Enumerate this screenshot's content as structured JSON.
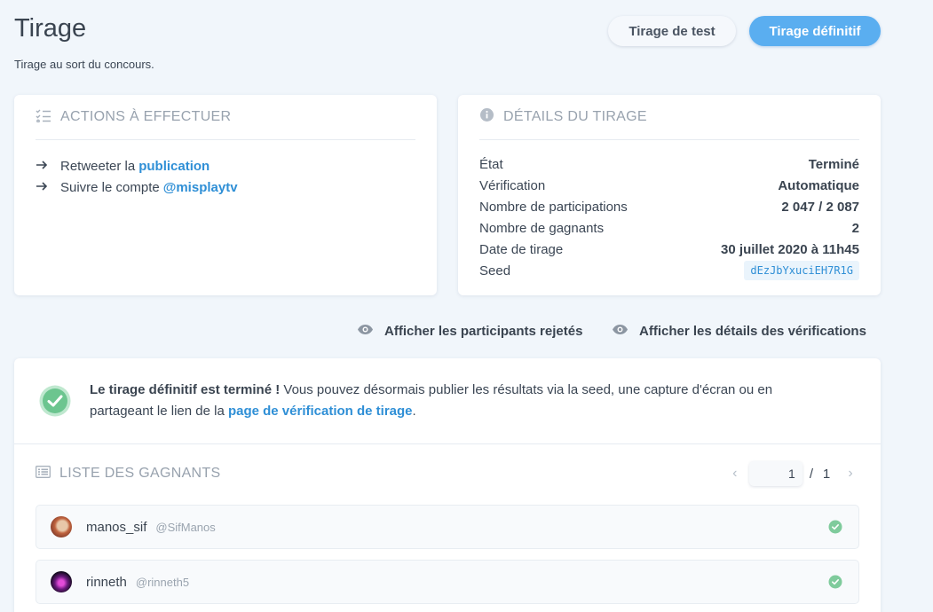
{
  "header": {
    "title": "Tirage",
    "subtitle": "Tirage au sort du concours.",
    "test_button": "Tirage de test",
    "final_button": "Tirage définitif"
  },
  "actions": {
    "title": "ACTIONS À EFFECTUER",
    "items": [
      {
        "text": "Retweeter la",
        "link": "publication"
      },
      {
        "text": "Suivre le compte",
        "link": "@misplaytv"
      }
    ]
  },
  "details": {
    "title": "DÉTAILS DU TIRAGE",
    "rows": [
      {
        "label": "État",
        "value": "Terminé"
      },
      {
        "label": "Vérification",
        "value": "Automatique"
      },
      {
        "label": "Nombre de participations",
        "value": "2 047 / 2 087"
      },
      {
        "label": "Nombre de gagnants",
        "value": "2"
      },
      {
        "label": "Date de tirage",
        "value": "30 juillet 2020 à 11h45"
      },
      {
        "label": "Seed",
        "value": "dEzJbYxuciEH7R1G"
      }
    ]
  },
  "links": {
    "rejected": "Afficher les participants rejetés",
    "verifications": "Afficher les détails des vérifications"
  },
  "result": {
    "bold": "Le tirage définitif est terminé !",
    "text": " Vous pouvez désormais publier les résultats via la seed, une capture d'écran ou en partageant le lien de la ",
    "link": "page de vérification de tirage",
    "end": "."
  },
  "winners": {
    "title": "LISTE DES GAGNANTS",
    "page": "1",
    "separator": "/",
    "total_pages": "1",
    "items": [
      {
        "name": "manos_sif",
        "handle": "@SifManos"
      },
      {
        "name": "rinneth",
        "handle": "@rinneth5"
      }
    ]
  },
  "colors": {
    "accent": "#2f8fd6",
    "primary_button": "#5aaef0",
    "success": "#6cc58f",
    "background": "#f1f6fb"
  },
  "icons": {
    "actions": "checklist-icon",
    "details": "info-icon",
    "link": "eye-icon",
    "winners": "list-icon",
    "status": "check-circle-icon"
  }
}
